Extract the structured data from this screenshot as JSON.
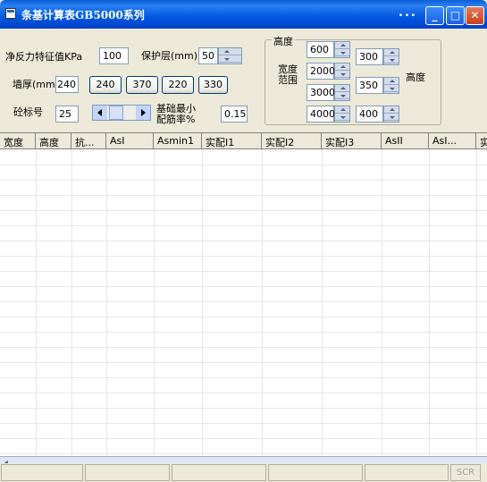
{
  "window": {
    "title": "条基计算表GB5000系列",
    "menu_dots": "...",
    "min_glyph": "_",
    "max_glyph": "□",
    "close_glyph": "✕"
  },
  "form": {
    "bearing_label": "净反力特征值KPa",
    "bearing_value": "100",
    "cover_label": "保护层(mm)",
    "cover_value": "50",
    "wall_label": "墙厚(mm)",
    "wall_value": "240",
    "wall_buttons": [
      "240",
      "370",
      "220",
      "330"
    ],
    "concrete_label": "砼标号",
    "concrete_value": "25",
    "min_ratio_label_1": "基础最小",
    "min_ratio_label_2": "配筋率%",
    "min_ratio_value": "0.15"
  },
  "range_group": {
    "title": "高度",
    "width_label_1": "宽度",
    "width_label_2": "范围",
    "height_label": "高度",
    "width_values": [
      "600",
      "2000",
      "3000",
      "4000"
    ],
    "height_values": [
      "300",
      "350",
      "400"
    ]
  },
  "table": {
    "columns": [
      "宽度",
      "高度",
      "抗...",
      "AsI",
      "Asmin1",
      "实配I1",
      "实配I2",
      "实配I3",
      "AsII",
      "AsI...",
      "实"
    ]
  },
  "status": {
    "panels": [
      "",
      "",
      "",
      "",
      "",
      "SCR"
    ]
  }
}
